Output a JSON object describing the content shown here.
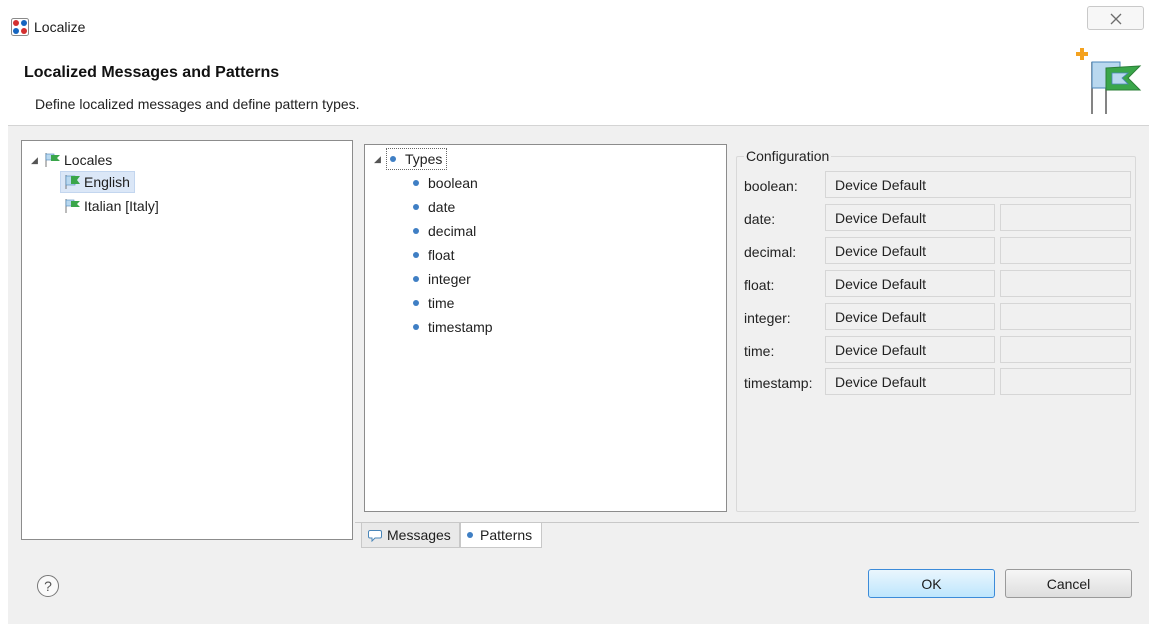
{
  "window": {
    "title": "Localize"
  },
  "header": {
    "title": "Localized Messages and Patterns",
    "description": "Define localized messages and define pattern types."
  },
  "locales_tree": {
    "root": "Locales",
    "items": [
      "English",
      "Italian [Italy]"
    ],
    "selected": "English"
  },
  "types_tree": {
    "root": "Types",
    "items": [
      "boolean",
      "date",
      "decimal",
      "float",
      "integer",
      "time",
      "timestamp"
    ]
  },
  "tabs": {
    "messages": "Messages",
    "patterns": "Patterns",
    "active": "Patterns"
  },
  "configuration": {
    "title": "Configuration",
    "rows": [
      {
        "label": "boolean:",
        "value": "Device Default"
      },
      {
        "label": "date:",
        "value": "Device Default"
      },
      {
        "label": "decimal:",
        "value": "Device Default"
      },
      {
        "label": "float:",
        "value": "Device Default"
      },
      {
        "label": "integer:",
        "value": "Device Default"
      },
      {
        "label": "time:",
        "value": "Device Default"
      },
      {
        "label": "timestamp:",
        "value": "Device Default"
      }
    ]
  },
  "buttons": {
    "ok": "OK",
    "cancel": "Cancel"
  },
  "help": {
    "glyph": "?"
  },
  "icons": {
    "close": "close-icon",
    "help": "help-icon",
    "flag": "flag-icon",
    "add": "plus-icon"
  },
  "colors": {
    "accent": "#3c8bd9",
    "bullet": "#3f7fc4",
    "selection": "#dbe7f7",
    "flag_green": "#3aa64a",
    "plus_orange": "#f4a21f"
  }
}
